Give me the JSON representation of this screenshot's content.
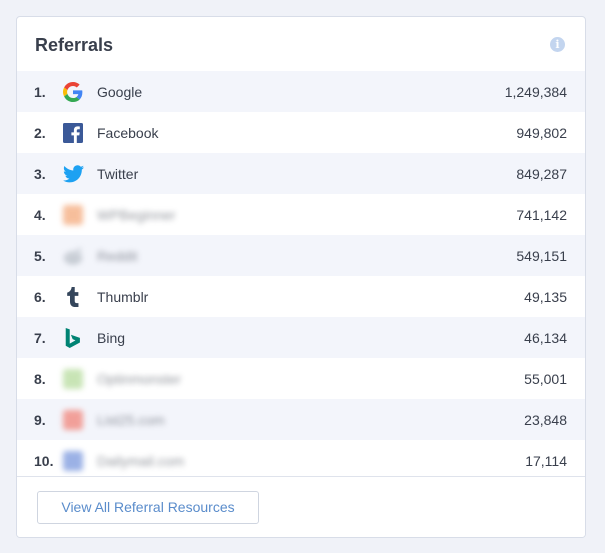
{
  "widget": {
    "title": "Referrals",
    "info_icon": "info-icon"
  },
  "referrals": [
    {
      "rank": "1.",
      "name": "Google",
      "count": "1,249,384",
      "icon": "google-icon",
      "blurred": false
    },
    {
      "rank": "2.",
      "name": "Facebook",
      "count": "949,802",
      "icon": "facebook-icon",
      "blurred": false
    },
    {
      "rank": "3.",
      "name": "Twitter",
      "count": "849,287",
      "icon": "twitter-icon",
      "blurred": false
    },
    {
      "rank": "4.",
      "name": "WPBeginner",
      "count": "741,142",
      "icon": "site-favicon-icon",
      "blurred": true
    },
    {
      "rank": "5.",
      "name": "Reddit",
      "count": "549,151",
      "icon": "reddit-icon",
      "blurred": true
    },
    {
      "rank": "6.",
      "name": "Thumblr",
      "count": "49,135",
      "icon": "tumblr-icon",
      "blurred": false
    },
    {
      "rank": "7.",
      "name": "Bing",
      "count": "46,134",
      "icon": "bing-icon",
      "blurred": false
    },
    {
      "rank": "8.",
      "name": "Optinmonster",
      "count": "55,001",
      "icon": "site-favicon-icon",
      "blurred": true
    },
    {
      "rank": "9.",
      "name": "List25.com",
      "count": "23,848",
      "icon": "site-favicon-icon",
      "blurred": true
    },
    {
      "rank": "10.",
      "name": "Dailymail.com",
      "count": "17,114",
      "icon": "site-favicon-icon",
      "blurred": true
    }
  ],
  "footer": {
    "view_all_label": "View All Referral Resources"
  },
  "colors": {
    "google_blue": "#4285F4",
    "google_red": "#EA4335",
    "google_yellow": "#FBBC05",
    "google_green": "#34A853",
    "facebook": "#3b5998",
    "twitter": "#1da1f2",
    "tumblr": "#35465c",
    "bing": "#008373",
    "link": "#5a8ccb"
  }
}
